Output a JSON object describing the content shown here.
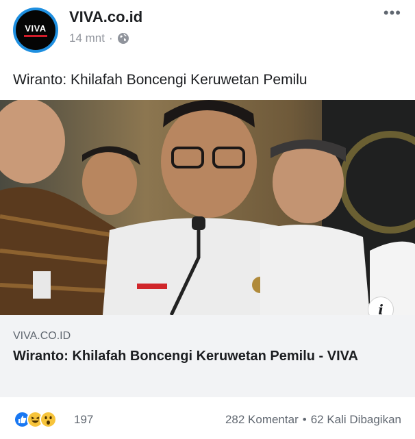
{
  "page": {
    "name": "VIVA.co.id",
    "avatar_text": "VIVA",
    "time": "14 mnt",
    "separator": "·",
    "more_label": "•••"
  },
  "post": {
    "text": "Wiranto: Khilafah Boncengi Keruwetan Pemilu"
  },
  "link": {
    "domain": "VIVA.CO.ID",
    "title": "Wiranto: Khilafah Boncengi Keruwetan Pemilu - VIVA",
    "info_icon": "i"
  },
  "reactions": {
    "icons": [
      "like-icon",
      "haha-icon",
      "wow-icon"
    ],
    "count": "197",
    "comments": "282 Komentar",
    "dot": "•",
    "shares": "62 Kali Dibagikan"
  },
  "colors": {
    "accent": "#1877f2",
    "avatar_ring": "#1e8fe0",
    "card_bg": "#f2f3f5"
  }
}
